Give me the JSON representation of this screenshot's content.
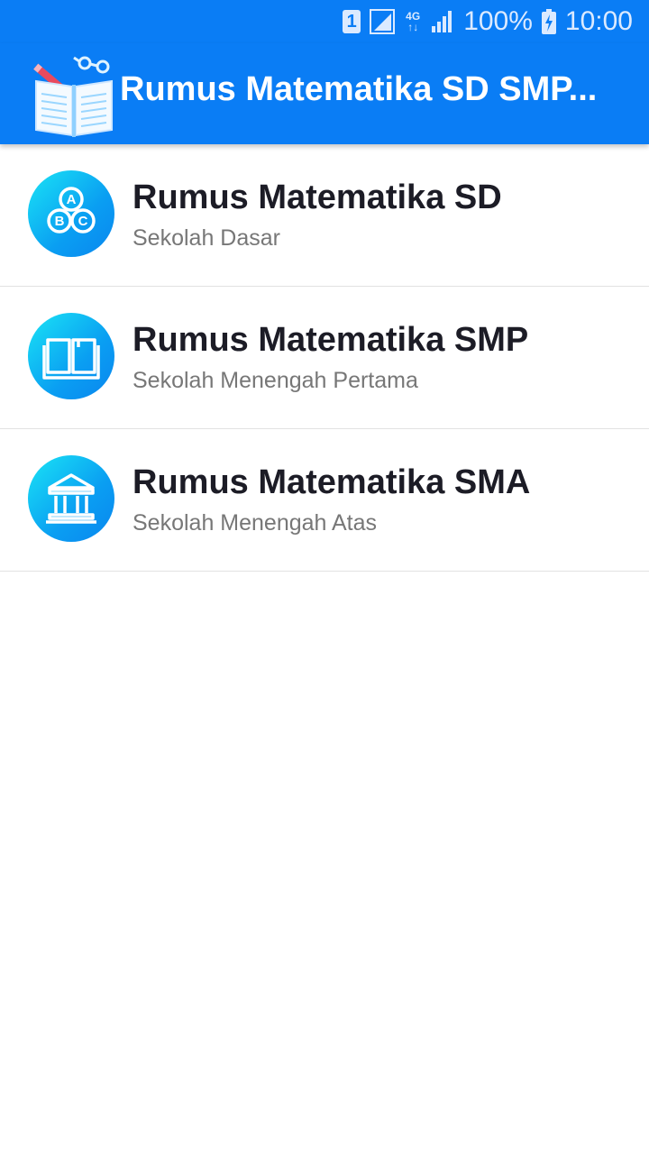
{
  "status_bar": {
    "sim": "1",
    "network": "4G",
    "battery": "100%",
    "time": "10:00"
  },
  "app_bar": {
    "title": "Rumus Matematika SD SMP..."
  },
  "items": [
    {
      "title": "Rumus Matematika SD",
      "subtitle": "Sekolah Dasar",
      "icon": "abc-blocks-icon"
    },
    {
      "title": "Rumus Matematika SMP",
      "subtitle": "Sekolah Menengah Pertama",
      "icon": "book-icon"
    },
    {
      "title": "Rumus Matematika SMA",
      "subtitle": "Sekolah Menengah Atas",
      "icon": "school-building-icon"
    }
  ],
  "colors": {
    "primary": "#0a7df5",
    "icon_gradient_start": "#1ae4f5",
    "icon_gradient_end": "#0a86ef",
    "title_text": "#1c1c26",
    "subtitle_text": "#777777"
  }
}
